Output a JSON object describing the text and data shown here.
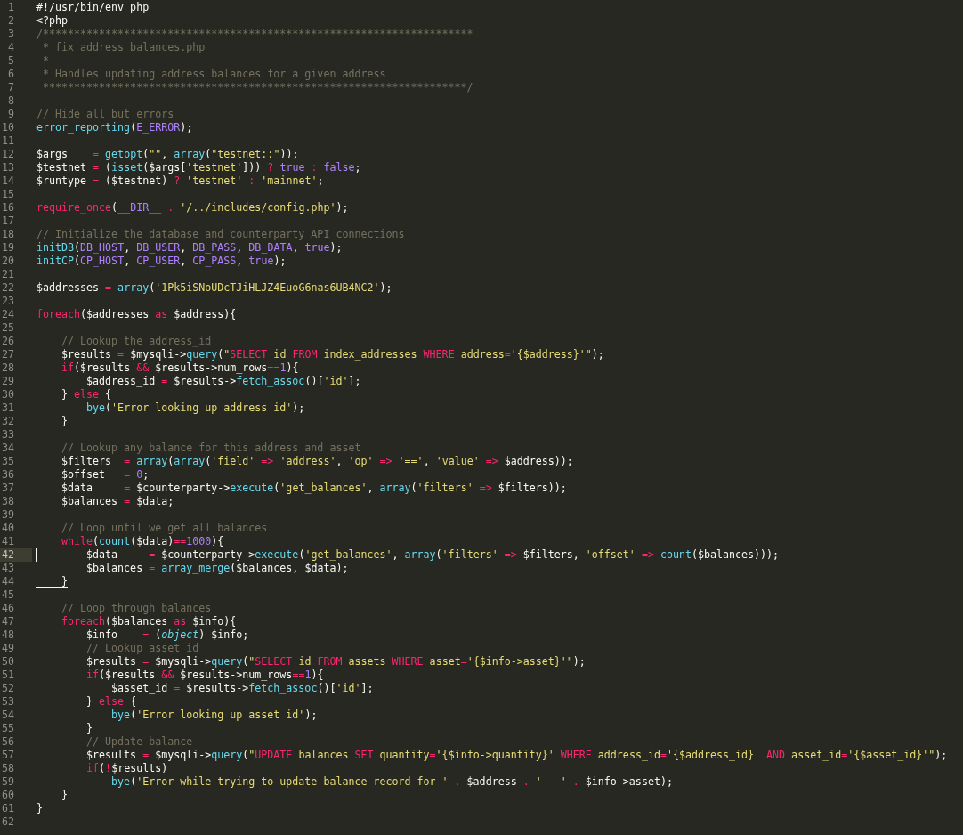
{
  "editor": {
    "lines": [
      {
        "number": "1",
        "current": false,
        "tokens": [
          {
            "text": "#!/usr/bin/env php",
            "kind": "plain"
          }
        ]
      },
      {
        "number": "2",
        "current": false,
        "tokens": [
          {
            "text": "<?php",
            "kind": "plain"
          }
        ]
      },
      {
        "number": "3",
        "current": false,
        "tokens": [
          {
            "text": "/*********************************************************************",
            "kind": "comment"
          }
        ]
      },
      {
        "number": "4",
        "current": false,
        "tokens": [
          {
            "text": " * fix_address_balances.php",
            "kind": "comment"
          }
        ]
      },
      {
        "number": "5",
        "current": false,
        "tokens": [
          {
            "text": " *",
            "kind": "comment"
          }
        ]
      },
      {
        "number": "6",
        "current": false,
        "tokens": [
          {
            "text": " * Handles updating address balances for a given address",
            "kind": "comment"
          }
        ]
      },
      {
        "number": "7",
        "current": false,
        "tokens": [
          {
            "text": " ********************************************************************/",
            "kind": "comment"
          }
        ]
      },
      {
        "number": "8",
        "current": false
      },
      {
        "number": "9",
        "current": false,
        "tokens": [
          {
            "text": "// Hide all but errors",
            "kind": "comment"
          }
        ]
      },
      {
        "number": "10",
        "current": false,
        "tokens": [
          {
            "text": "error_reporting",
            "kind": "function"
          },
          {
            "text": "(",
            "kind": "plain"
          },
          {
            "text": "E_ERROR",
            "kind": "constant"
          },
          {
            "text": ");",
            "kind": "plain"
          }
        ]
      },
      {
        "number": "11",
        "current": false
      },
      {
        "number": "12",
        "current": false,
        "tokens": [
          {
            "text": "$args    ",
            "kind": "plain"
          },
          {
            "text": "=",
            "kind": "keyword"
          },
          {
            "text": " getopt",
            "kind": "function"
          },
          {
            "text": "(",
            "kind": "plain"
          },
          {
            "text": "\"\"",
            "kind": "string"
          },
          {
            "text": ", ",
            "kind": "plain"
          },
          {
            "text": "array",
            "kind": "function"
          },
          {
            "text": "(",
            "kind": "plain"
          },
          {
            "text": "\"testnet::\"",
            "kind": "string"
          },
          {
            "text": "));",
            "kind": "plain"
          }
        ]
      },
      {
        "number": "13",
        "current": false,
        "tokens": [
          {
            "text": "$testnet ",
            "kind": "plain"
          },
          {
            "text": "=",
            "kind": "keyword"
          },
          {
            "text": " (",
            "kind": "plain"
          },
          {
            "text": "isset",
            "kind": "function"
          },
          {
            "text": "($args[",
            "kind": "plain"
          },
          {
            "text": "'testnet'",
            "kind": "string"
          },
          {
            "text": "])) ",
            "kind": "plain"
          },
          {
            "text": "?",
            "kind": "keyword"
          },
          {
            "text": " true",
            "kind": "constant"
          },
          {
            "text": " :",
            "kind": "keyword"
          },
          {
            "text": " false",
            "kind": "constant"
          },
          {
            "text": ";",
            "kind": "plain"
          }
        ]
      },
      {
        "number": "14",
        "current": false,
        "tokens": [
          {
            "text": "$runtype ",
            "kind": "plain"
          },
          {
            "text": "=",
            "kind": "keyword"
          },
          {
            "text": " ($testnet) ",
            "kind": "plain"
          },
          {
            "text": "?",
            "kind": "keyword"
          },
          {
            "text": " 'testnet'",
            "kind": "string"
          },
          {
            "text": " :",
            "kind": "keyword"
          },
          {
            "text": " 'mainnet'",
            "kind": "string"
          },
          {
            "text": ";",
            "kind": "plain"
          }
        ]
      },
      {
        "number": "15",
        "current": false
      },
      {
        "number": "16",
        "current": false,
        "tokens": [
          {
            "text": "require_once",
            "kind": "keyword"
          },
          {
            "text": "(",
            "kind": "plain"
          },
          {
            "text": "__DIR__",
            "kind": "constant"
          },
          {
            "text": " .",
            "kind": "keyword"
          },
          {
            "text": " '/../includes/config.php'",
            "kind": "string"
          },
          {
            "text": ");",
            "kind": "plain"
          }
        ]
      },
      {
        "number": "17",
        "current": false
      },
      {
        "number": "18",
        "current": false,
        "tokens": [
          {
            "text": "// Initialize the database and counterparty API connections",
            "kind": "comment"
          }
        ]
      },
      {
        "number": "19",
        "current": false,
        "tokens": [
          {
            "text": "initDB",
            "kind": "function"
          },
          {
            "text": "(",
            "kind": "plain"
          },
          {
            "text": "DB_HOST",
            "kind": "constant"
          },
          {
            "text": ", ",
            "kind": "plain"
          },
          {
            "text": "DB_USER",
            "kind": "constant"
          },
          {
            "text": ", ",
            "kind": "plain"
          },
          {
            "text": "DB_PASS",
            "kind": "constant"
          },
          {
            "text": ", ",
            "kind": "plain"
          },
          {
            "text": "DB_DATA",
            "kind": "constant"
          },
          {
            "text": ", ",
            "kind": "plain"
          },
          {
            "text": "true",
            "kind": "constant"
          },
          {
            "text": ");",
            "kind": "plain"
          }
        ]
      },
      {
        "number": "20",
        "current": false,
        "tokens": [
          {
            "text": "initCP",
            "kind": "function"
          },
          {
            "text": "(",
            "kind": "plain"
          },
          {
            "text": "CP_HOST",
            "kind": "constant"
          },
          {
            "text": ", ",
            "kind": "plain"
          },
          {
            "text": "CP_USER",
            "kind": "constant"
          },
          {
            "text": ", ",
            "kind": "plain"
          },
          {
            "text": "CP_PASS",
            "kind": "constant"
          },
          {
            "text": ", ",
            "kind": "plain"
          },
          {
            "text": "true",
            "kind": "constant"
          },
          {
            "text": ");",
            "kind": "plain"
          }
        ]
      },
      {
        "number": "21",
        "current": false
      },
      {
        "number": "22",
        "current": false,
        "tokens": [
          {
            "text": "$addresses ",
            "kind": "plain"
          },
          {
            "text": "=",
            "kind": "keyword"
          },
          {
            "text": " array",
            "kind": "function"
          },
          {
            "text": "(",
            "kind": "plain"
          },
          {
            "text": "'1Pk5iSNoUDcTJiHLJZ4EuoG6nas6UB4NC2'",
            "kind": "string"
          },
          {
            "text": ");",
            "kind": "plain"
          }
        ]
      },
      {
        "number": "23",
        "current": false
      },
      {
        "number": "24",
        "current": false,
        "tokens": [
          {
            "text": "foreach",
            "kind": "keyword"
          },
          {
            "text": "($addresses ",
            "kind": "plain"
          },
          {
            "text": "as",
            "kind": "keyword"
          },
          {
            "text": " $address){",
            "kind": "plain"
          }
        ]
      },
      {
        "number": "25",
        "current": false
      },
      {
        "number": "26",
        "current": false,
        "tokens": [
          {
            "text": "    // Lookup the address_id",
            "kind": "comment"
          }
        ]
      },
      {
        "number": "27",
        "current": false,
        "tokens": [
          {
            "text": "    $results ",
            "kind": "plain"
          },
          {
            "text": "=",
            "kind": "keyword"
          },
          {
            "text": " $mysqli->",
            "kind": "plain"
          },
          {
            "text": "query",
            "kind": "function"
          },
          {
            "text": "(",
            "kind": "plain"
          },
          {
            "text": "\"",
            "kind": "string"
          },
          {
            "text": "SELECT",
            "kind": "keyword"
          },
          {
            "text": " id ",
            "kind": "string"
          },
          {
            "text": "FROM",
            "kind": "keyword"
          },
          {
            "text": " index_addresses ",
            "kind": "string"
          },
          {
            "text": "WHERE",
            "kind": "keyword"
          },
          {
            "text": " address",
            "kind": "string"
          },
          {
            "text": "=",
            "kind": "keyword"
          },
          {
            "text": "'{$address}'\"",
            "kind": "string"
          },
          {
            "text": ");",
            "kind": "plain"
          }
        ]
      },
      {
        "number": "28",
        "current": false,
        "tokens": [
          {
            "text": "    if",
            "kind": "keyword"
          },
          {
            "text": "($results ",
            "kind": "plain"
          },
          {
            "text": "&&",
            "kind": "keyword"
          },
          {
            "text": " $results->num_rows",
            "kind": "plain"
          },
          {
            "text": "==",
            "kind": "keyword"
          },
          {
            "text": "1",
            "kind": "constant"
          },
          {
            "text": "){",
            "kind": "plain"
          }
        ]
      },
      {
        "number": "29",
        "current": false,
        "tokens": [
          {
            "text": "        $address_id ",
            "kind": "plain"
          },
          {
            "text": "=",
            "kind": "keyword"
          },
          {
            "text": " $results->",
            "kind": "plain"
          },
          {
            "text": "fetch_assoc",
            "kind": "function"
          },
          {
            "text": "()[",
            "kind": "plain"
          },
          {
            "text": "'id'",
            "kind": "string"
          },
          {
            "text": "];",
            "kind": "plain"
          }
        ]
      },
      {
        "number": "30",
        "current": false,
        "tokens": [
          {
            "text": "    } ",
            "kind": "plain"
          },
          {
            "text": "else",
            "kind": "keyword"
          },
          {
            "text": " {",
            "kind": "plain"
          }
        ]
      },
      {
        "number": "31",
        "current": false,
        "tokens": [
          {
            "text": "        bye",
            "kind": "function"
          },
          {
            "text": "(",
            "kind": "plain"
          },
          {
            "text": "'Error looking up address id'",
            "kind": "string"
          },
          {
            "text": ");",
            "kind": "plain"
          }
        ]
      },
      {
        "number": "32",
        "current": false,
        "tokens": [
          {
            "text": "    }",
            "kind": "plain"
          }
        ]
      },
      {
        "number": "33",
        "current": false
      },
      {
        "number": "34",
        "current": false,
        "tokens": [
          {
            "text": "    // Lookup any balance for this address and asset",
            "kind": "comment"
          }
        ]
      },
      {
        "number": "35",
        "current": false,
        "tokens": [
          {
            "text": "    $filters  ",
            "kind": "plain"
          },
          {
            "text": "=",
            "kind": "keyword"
          },
          {
            "text": " array",
            "kind": "function"
          },
          {
            "text": "(",
            "kind": "plain"
          },
          {
            "text": "array",
            "kind": "function"
          },
          {
            "text": "(",
            "kind": "plain"
          },
          {
            "text": "'field'",
            "kind": "string"
          },
          {
            "text": " =>",
            "kind": "keyword"
          },
          {
            "text": " 'address'",
            "kind": "string"
          },
          {
            "text": ", ",
            "kind": "plain"
          },
          {
            "text": "'op'",
            "kind": "string"
          },
          {
            "text": " =>",
            "kind": "keyword"
          },
          {
            "text": " '=='",
            "kind": "string"
          },
          {
            "text": ", ",
            "kind": "plain"
          },
          {
            "text": "'value'",
            "kind": "string"
          },
          {
            "text": " =>",
            "kind": "keyword"
          },
          {
            "text": " $address));",
            "kind": "plain"
          }
        ]
      },
      {
        "number": "36",
        "current": false,
        "tokens": [
          {
            "text": "    $offset   ",
            "kind": "plain"
          },
          {
            "text": "=",
            "kind": "keyword"
          },
          {
            "text": " 0",
            "kind": "constant"
          },
          {
            "text": ";",
            "kind": "plain"
          }
        ]
      },
      {
        "number": "37",
        "current": false,
        "tokens": [
          {
            "text": "    $data     ",
            "kind": "plain"
          },
          {
            "text": "=",
            "kind": "keyword"
          },
          {
            "text": " $counterparty->",
            "kind": "plain"
          },
          {
            "text": "execute",
            "kind": "function"
          },
          {
            "text": "(",
            "kind": "plain"
          },
          {
            "text": "'get_balances'",
            "kind": "string"
          },
          {
            "text": ", ",
            "kind": "plain"
          },
          {
            "text": "array",
            "kind": "function"
          },
          {
            "text": "(",
            "kind": "plain"
          },
          {
            "text": "'filters'",
            "kind": "string"
          },
          {
            "text": " =>",
            "kind": "keyword"
          },
          {
            "text": " $filters));",
            "kind": "plain"
          }
        ]
      },
      {
        "number": "38",
        "current": false,
        "tokens": [
          {
            "text": "    $balances ",
            "kind": "plain"
          },
          {
            "text": "=",
            "kind": "keyword"
          },
          {
            "text": " $data;",
            "kind": "plain"
          }
        ]
      },
      {
        "number": "39",
        "current": false
      },
      {
        "number": "40",
        "current": false,
        "tokens": [
          {
            "text": "    // Loop until we get all balances",
            "kind": "comment"
          }
        ]
      },
      {
        "number": "41",
        "current": false,
        "tokens": [
          {
            "text": "    while",
            "kind": "keyword"
          },
          {
            "text": "(",
            "kind": "plain"
          },
          {
            "text": "count",
            "kind": "function"
          },
          {
            "text": "($data)",
            "kind": "plain"
          },
          {
            "text": "==",
            "kind": "keyword"
          },
          {
            "text": "1000",
            "kind": "constant"
          },
          {
            "text": ")",
            "kind": "plain"
          },
          {
            "text": "{",
            "kind": "matched-bracket"
          }
        ]
      },
      {
        "number": "42",
        "current": true,
        "tokens": [
          {
            "text": "        $data     ",
            "kind": "plain"
          },
          {
            "text": "=",
            "kind": "keyword"
          },
          {
            "text": " $counterparty->",
            "kind": "plain"
          },
          {
            "text": "execute",
            "kind": "function"
          },
          {
            "text": "(",
            "kind": "plain"
          },
          {
            "text": "'get_balances'",
            "kind": "string"
          },
          {
            "text": ", ",
            "kind": "plain"
          },
          {
            "text": "array",
            "kind": "function"
          },
          {
            "text": "(",
            "kind": "plain"
          },
          {
            "text": "'filters'",
            "kind": "string"
          },
          {
            "text": " =>",
            "kind": "keyword"
          },
          {
            "text": " $filters, ",
            "kind": "plain"
          },
          {
            "text": "'offset'",
            "kind": "string"
          },
          {
            "text": " =>",
            "kind": "keyword"
          },
          {
            "text": " count",
            "kind": "function"
          },
          {
            "text": "($balances)));",
            "kind": "plain"
          }
        ]
      },
      {
        "number": "43",
        "current": false,
        "tokens": [
          {
            "text": "        $balances ",
            "kind": "plain"
          },
          {
            "text": "=",
            "kind": "keyword"
          },
          {
            "text": " array_merge",
            "kind": "function"
          },
          {
            "text": "($balances, $data);",
            "kind": "plain"
          }
        ]
      },
      {
        "number": "44",
        "current": false,
        "tokens": [
          {
            "text": "    }",
            "kind": "matched-bracket"
          }
        ]
      },
      {
        "number": "45",
        "current": false
      },
      {
        "number": "46",
        "current": false,
        "tokens": [
          {
            "text": "    // Loop through balances",
            "kind": "comment"
          }
        ]
      },
      {
        "number": "47",
        "current": false,
        "tokens": [
          {
            "text": "    foreach",
            "kind": "keyword"
          },
          {
            "text": "($balances ",
            "kind": "plain"
          },
          {
            "text": "as",
            "kind": "keyword"
          },
          {
            "text": " $info){",
            "kind": "plain"
          }
        ]
      },
      {
        "number": "48",
        "current": false,
        "tokens": [
          {
            "text": "        $info    ",
            "kind": "plain"
          },
          {
            "text": "=",
            "kind": "keyword"
          },
          {
            "text": " (",
            "kind": "plain"
          },
          {
            "text": "object",
            "kind": "type"
          },
          {
            "text": ") $info;",
            "kind": "plain"
          }
        ]
      },
      {
        "number": "49",
        "current": false,
        "tokens": [
          {
            "text": "        // Lookup asset id",
            "kind": "comment"
          }
        ]
      },
      {
        "number": "50",
        "current": false,
        "tokens": [
          {
            "text": "        $results ",
            "kind": "plain"
          },
          {
            "text": "=",
            "kind": "keyword"
          },
          {
            "text": " $mysqli->",
            "kind": "plain"
          },
          {
            "text": "query",
            "kind": "function"
          },
          {
            "text": "(",
            "kind": "plain"
          },
          {
            "text": "\"",
            "kind": "string"
          },
          {
            "text": "SELECT",
            "kind": "keyword"
          },
          {
            "text": " id ",
            "kind": "string"
          },
          {
            "text": "FROM",
            "kind": "keyword"
          },
          {
            "text": " assets ",
            "kind": "string"
          },
          {
            "text": "WHERE",
            "kind": "keyword"
          },
          {
            "text": " asset",
            "kind": "string"
          },
          {
            "text": "=",
            "kind": "keyword"
          },
          {
            "text": "'{$info->asset}'\"",
            "kind": "string"
          },
          {
            "text": ");",
            "kind": "plain"
          }
        ]
      },
      {
        "number": "51",
        "current": false,
        "tokens": [
          {
            "text": "        if",
            "kind": "keyword"
          },
          {
            "text": "($results ",
            "kind": "plain"
          },
          {
            "text": "&&",
            "kind": "keyword"
          },
          {
            "text": " $results->num_rows",
            "kind": "plain"
          },
          {
            "text": "==",
            "kind": "keyword"
          },
          {
            "text": "1",
            "kind": "constant"
          },
          {
            "text": "){",
            "kind": "plain"
          }
        ]
      },
      {
        "number": "52",
        "current": false,
        "tokens": [
          {
            "text": "            $asset_id ",
            "kind": "plain"
          },
          {
            "text": "=",
            "kind": "keyword"
          },
          {
            "text": " $results->",
            "kind": "plain"
          },
          {
            "text": "fetch_assoc",
            "kind": "function"
          },
          {
            "text": "()[",
            "kind": "plain"
          },
          {
            "text": "'id'",
            "kind": "string"
          },
          {
            "text": "];",
            "kind": "plain"
          }
        ]
      },
      {
        "number": "53",
        "current": false,
        "tokens": [
          {
            "text": "        } ",
            "kind": "plain"
          },
          {
            "text": "else",
            "kind": "keyword"
          },
          {
            "text": " {",
            "kind": "plain"
          }
        ]
      },
      {
        "number": "54",
        "current": false,
        "tokens": [
          {
            "text": "            bye",
            "kind": "function"
          },
          {
            "text": "(",
            "kind": "plain"
          },
          {
            "text": "'Error looking up asset id'",
            "kind": "string"
          },
          {
            "text": ");",
            "kind": "plain"
          }
        ]
      },
      {
        "number": "55",
        "current": false,
        "tokens": [
          {
            "text": "        }",
            "kind": "plain"
          }
        ]
      },
      {
        "number": "56",
        "current": false,
        "tokens": [
          {
            "text": "        // Update balance",
            "kind": "comment"
          }
        ]
      },
      {
        "number": "57",
        "current": false,
        "tokens": [
          {
            "text": "        $results ",
            "kind": "plain"
          },
          {
            "text": "=",
            "kind": "keyword"
          },
          {
            "text": " $mysqli->",
            "kind": "plain"
          },
          {
            "text": "query",
            "kind": "function"
          },
          {
            "text": "(",
            "kind": "plain"
          },
          {
            "text": "\"",
            "kind": "string"
          },
          {
            "text": "UPDATE",
            "kind": "keyword"
          },
          {
            "text": " balances ",
            "kind": "string"
          },
          {
            "text": "SET",
            "kind": "keyword"
          },
          {
            "text": " quantity",
            "kind": "string"
          },
          {
            "text": "=",
            "kind": "keyword"
          },
          {
            "text": "'{$info->quantity}' ",
            "kind": "string"
          },
          {
            "text": "WHERE",
            "kind": "keyword"
          },
          {
            "text": " address_id",
            "kind": "string"
          },
          {
            "text": "=",
            "kind": "keyword"
          },
          {
            "text": "'{$address_id}' ",
            "kind": "string"
          },
          {
            "text": "AND",
            "kind": "keyword"
          },
          {
            "text": " asset_id",
            "kind": "string"
          },
          {
            "text": "=",
            "kind": "keyword"
          },
          {
            "text": "'{$asset_id}'\"",
            "kind": "string"
          },
          {
            "text": ");",
            "kind": "plain"
          }
        ]
      },
      {
        "number": "58",
        "current": false,
        "tokens": [
          {
            "text": "        if",
            "kind": "keyword"
          },
          {
            "text": "(",
            "kind": "plain"
          },
          {
            "text": "!",
            "kind": "keyword"
          },
          {
            "text": "$results)",
            "kind": "plain"
          }
        ]
      },
      {
        "number": "59",
        "current": false,
        "tokens": [
          {
            "text": "            bye",
            "kind": "function"
          },
          {
            "text": "(",
            "kind": "plain"
          },
          {
            "text": "'Error while trying to update balance record for '",
            "kind": "string"
          },
          {
            "text": " .",
            "kind": "keyword"
          },
          {
            "text": " $address ",
            "kind": "plain"
          },
          {
            "text": ".",
            "kind": "keyword"
          },
          {
            "text": " ' - '",
            "kind": "string"
          },
          {
            "text": " .",
            "kind": "keyword"
          },
          {
            "text": " $info->asset);",
            "kind": "plain"
          }
        ]
      },
      {
        "number": "60",
        "current": false,
        "tokens": [
          {
            "text": "    }",
            "kind": "plain"
          }
        ]
      },
      {
        "number": "61",
        "current": false,
        "tokens": [
          {
            "text": "}",
            "kind": "plain"
          }
        ]
      },
      {
        "number": "62",
        "current": false
      }
    ]
  }
}
